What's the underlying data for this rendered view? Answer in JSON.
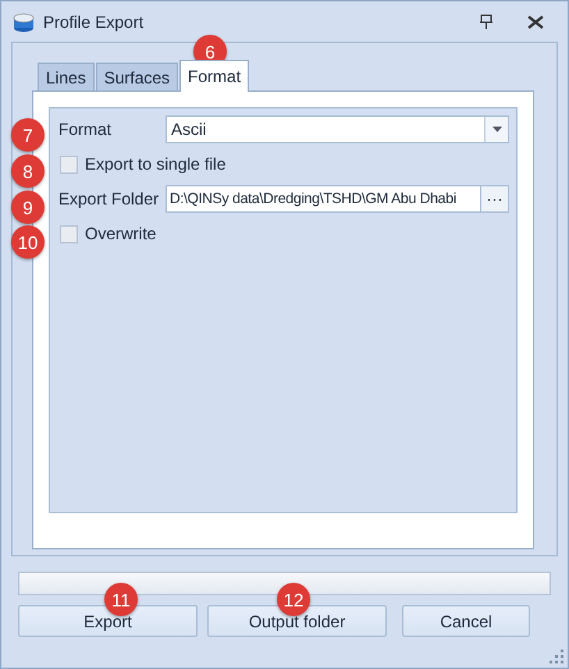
{
  "window": {
    "title": "Profile Export"
  },
  "tabs": [
    {
      "label": "Lines",
      "selected": false
    },
    {
      "label": "Surfaces",
      "selected": false
    },
    {
      "label": "Format",
      "selected": true
    }
  ],
  "form": {
    "rows": [
      {
        "kind": "combo",
        "label": "Format",
        "value": "Ascii"
      },
      {
        "kind": "checkbox",
        "label": "Export to single file",
        "checked": false
      },
      {
        "kind": "path",
        "label": "Export Folder",
        "value": "D:\\QINSy data\\Dredging\\TSHD\\GM Abu Dhabi",
        "button": "···"
      },
      {
        "kind": "checkbox",
        "label": "Overwrite",
        "checked": false
      }
    ]
  },
  "progress": {
    "level": 0
  },
  "buttons": [
    "Export",
    "Output folder",
    "Cancel"
  ],
  "callouts": [
    "6",
    "7",
    "8",
    "9",
    "10",
    "11",
    "12"
  ]
}
